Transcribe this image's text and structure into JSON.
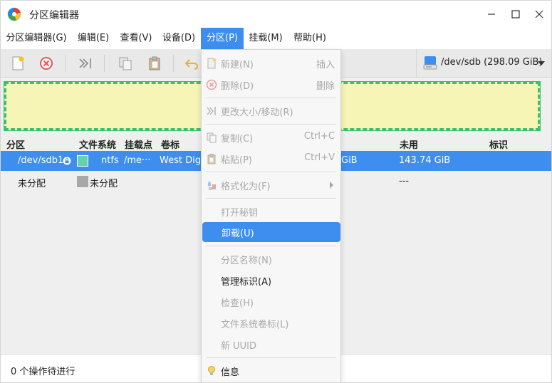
{
  "window": {
    "title": "分区编辑器"
  },
  "menubar": {
    "items": [
      {
        "label": "分区编辑器(G)"
      },
      {
        "label": "编辑(E)"
      },
      {
        "label": "查看(V)"
      },
      {
        "label": "设备(D)"
      },
      {
        "label": "分区(P)"
      },
      {
        "label": "挂载(M)"
      },
      {
        "label": "帮助(H)"
      }
    ]
  },
  "toolbar": {
    "device": "/dev/sdb (298.09 GiB)"
  },
  "table": {
    "columns": {
      "partition": "分区",
      "filesystem": "文件系统",
      "mountpoint": "挂载点",
      "label": "卷标",
      "unused": "未用",
      "flags": "标识"
    },
    "rows": [
      {
        "partition": "/dev/sdb1",
        "fs_color": "#67d1a8",
        "filesystem": "ntfs",
        "mountpoint": "/me···",
        "label": "West Digi",
        "used_partial": "GiB",
        "unused": "143.74 GiB"
      },
      {
        "partition": "未分配",
        "fs_color": "#a8a8a8",
        "filesystem": "未分配",
        "unused": "---"
      }
    ]
  },
  "status": {
    "text": "0 个操作待进行"
  },
  "dropdown": {
    "items": [
      {
        "label": "新建(N)",
        "shortcut": "插入"
      },
      {
        "label": "删除(D)",
        "shortcut": "删除"
      },
      {
        "label": "更改大小/移动(R)"
      },
      {
        "label": "复制(C)",
        "shortcut": "Ctrl+C"
      },
      {
        "label": "粘贴(P)",
        "shortcut": "Ctrl+V"
      },
      {
        "label": "格式化为(F)"
      },
      {
        "label": "打开秘钥"
      },
      {
        "label": "卸载(U)"
      },
      {
        "label": "分区名称(N)"
      },
      {
        "label": "管理标识(A)"
      },
      {
        "label": "检查(H)"
      },
      {
        "label": "文件系统卷标(L)"
      },
      {
        "label": "新 UUID"
      },
      {
        "label": "信息"
      }
    ]
  },
  "colors": {
    "accent": "#3e8ef0",
    "disk_fill": "#f6f5b5",
    "disk_border": "#3cc06d"
  }
}
